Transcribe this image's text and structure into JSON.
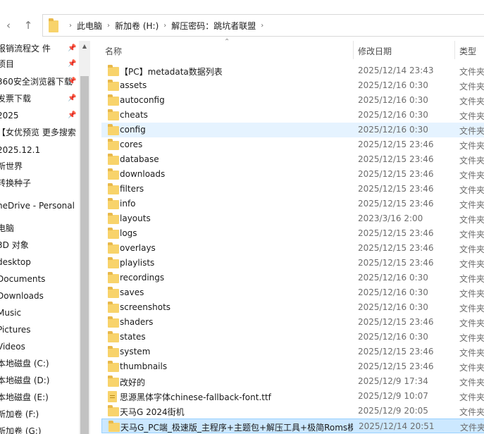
{
  "toolbar": {
    "back_glyph": "‹",
    "up_glyph": "↑"
  },
  "breadcrumb": {
    "items": [
      "此电脑",
      "新加卷 (H:)",
      "解压密码：跳坑者联盟"
    ]
  },
  "sidebar": {
    "items": [
      {
        "label": "报销流程文 件",
        "pinned": true
      },
      {
        "label": "项目",
        "pinned": true
      },
      {
        "label": "360安全浏览器下载",
        "pinned": true
      },
      {
        "label": "发票下载",
        "pinned": true
      },
      {
        "label": "2025",
        "pinned": true
      },
      {
        "label": "【女优预览 更多搜索",
        "pinned": false
      },
      {
        "label": "2025.12.1",
        "pinned": false
      },
      {
        "label": "新世界",
        "pinned": false
      },
      {
        "label": "转换种子",
        "pinned": false
      },
      {
        "label": "neDrive - Personal",
        "pinned": false
      },
      {
        "label": "电脑",
        "pinned": false
      },
      {
        "label": "3D 对象",
        "pinned": false
      },
      {
        "label": "desktop",
        "pinned": false
      },
      {
        "label": "Documents",
        "pinned": false
      },
      {
        "label": "Downloads",
        "pinned": false
      },
      {
        "label": "Music",
        "pinned": false
      },
      {
        "label": "Pictures",
        "pinned": false
      },
      {
        "label": "Videos",
        "pinned": false
      },
      {
        "label": "本地磁盘 (C:)",
        "pinned": false
      },
      {
        "label": "本地磁盘 (D:)",
        "pinned": false
      },
      {
        "label": "本地磁盘 (E:)",
        "pinned": false
      },
      {
        "label": "新加卷 (F:)",
        "pinned": false
      },
      {
        "label": "新加卷 (G:)",
        "pinned": false
      }
    ]
  },
  "columns": {
    "name": "名称",
    "date": "修改日期",
    "type": "类型"
  },
  "files": [
    {
      "name": "【PC】metadata数据列表",
      "date": "2025/12/14 23:43",
      "type": "文件夹",
      "icon": "folder-icon"
    },
    {
      "name": "assets",
      "date": "2025/12/16 0:30",
      "type": "文件夹",
      "icon": "folder-icon"
    },
    {
      "name": "autoconfig",
      "date": "2025/12/16 0:30",
      "type": "文件夹",
      "icon": "folder-icon"
    },
    {
      "name": "cheats",
      "date": "2025/12/16 0:30",
      "type": "文件夹",
      "icon": "folder-icon"
    },
    {
      "name": "config",
      "date": "2025/12/16 0:30",
      "type": "文件夹",
      "icon": "folder-icon",
      "state": "hover"
    },
    {
      "name": "cores",
      "date": "2025/12/15 23:46",
      "type": "文件夹",
      "icon": "folder-icon"
    },
    {
      "name": "database",
      "date": "2025/12/15 23:46",
      "type": "文件夹",
      "icon": "folder-icon"
    },
    {
      "name": "downloads",
      "date": "2025/12/15 23:46",
      "type": "文件夹",
      "icon": "folder-icon"
    },
    {
      "name": "filters",
      "date": "2025/12/15 23:46",
      "type": "文件夹",
      "icon": "folder-icon"
    },
    {
      "name": "info",
      "date": "2025/12/15 23:46",
      "type": "文件夹",
      "icon": "folder-icon"
    },
    {
      "name": "layouts",
      "date": "2023/3/16 2:00",
      "type": "文件夹",
      "icon": "folder-icon"
    },
    {
      "name": "logs",
      "date": "2025/12/15 23:46",
      "type": "文件夹",
      "icon": "folder-icon"
    },
    {
      "name": "overlays",
      "date": "2025/12/15 23:46",
      "type": "文件夹",
      "icon": "folder-icon"
    },
    {
      "name": "playlists",
      "date": "2025/12/15 23:46",
      "type": "文件夹",
      "icon": "folder-icon"
    },
    {
      "name": "recordings",
      "date": "2025/12/16 0:30",
      "type": "文件夹",
      "icon": "folder-icon"
    },
    {
      "name": "saves",
      "date": "2025/12/16 0:30",
      "type": "文件夹",
      "icon": "folder-icon"
    },
    {
      "name": "screenshots",
      "date": "2025/12/16 0:30",
      "type": "文件夹",
      "icon": "folder-icon"
    },
    {
      "name": "shaders",
      "date": "2025/12/15 23:46",
      "type": "文件夹",
      "icon": "folder-icon"
    },
    {
      "name": "states",
      "date": "2025/12/16 0:30",
      "type": "文件夹",
      "icon": "folder-icon"
    },
    {
      "name": "system",
      "date": "2025/12/15 23:46",
      "type": "文件夹",
      "icon": "folder-icon"
    },
    {
      "name": "thumbnails",
      "date": "2025/12/15 23:46",
      "type": "文件夹",
      "icon": "folder-icon"
    },
    {
      "name": "改好的",
      "date": "2025/12/9 17:34",
      "type": "文件夹",
      "icon": "folder-icon"
    },
    {
      "name": "思源黑体字体chinese-fallback-font.ttf",
      "date": "2025/12/9 10:07",
      "type": "文件夹",
      "icon": "file-icon"
    },
    {
      "name": "天马G 2024街机",
      "date": "2025/12/9 20:05",
      "type": "文件夹",
      "icon": "folder-icon"
    },
    {
      "name": "天马G_PC端_极速版_主程序+主题包+解压工具+极简Roms模板",
      "date": "2025/12/14 20:51",
      "type": "文件夹",
      "icon": "folder-icon",
      "state": "selected"
    }
  ],
  "colors": {
    "selection": "#cce8ff",
    "hover": "#e5f3ff",
    "folder": "#f8d36b"
  }
}
